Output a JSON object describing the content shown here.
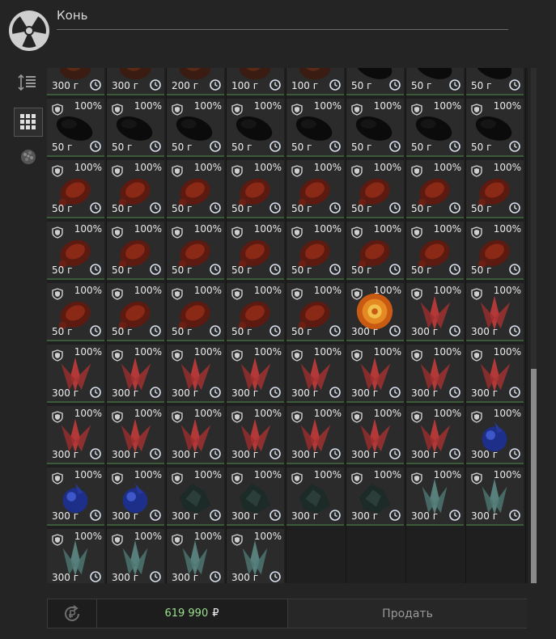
{
  "header": {
    "title": "Конь"
  },
  "sidebar": [
    {
      "name": "sort-icon",
      "active": false
    },
    {
      "name": "grid-view-icon",
      "active": true
    },
    {
      "name": "artifact-filter-icon",
      "active": false
    }
  ],
  "inventory": {
    "columns": 8,
    "item_types": {
      "black": {
        "icon": "black-artifact-icon"
      },
      "red": {
        "icon": "red-artifact-icon"
      },
      "fire": {
        "icon": "fireball-artifact-icon"
      },
      "crystal": {
        "icon": "red-crystal-artifact-icon"
      },
      "blue": {
        "icon": "blue-artifact-icon"
      },
      "dark": {
        "icon": "dark-crystal-artifact-icon"
      },
      "teal": {
        "icon": "teal-crystal-artifact-icon"
      },
      "mixed": {
        "icon": "artifact-icon"
      }
    },
    "rows": [
      [
        {
          "type": "mixed",
          "price": "300 г"
        },
        {
          "type": "mixed",
          "price": "300 г"
        },
        {
          "type": "mixed",
          "price": "200 г"
        },
        {
          "type": "mixed",
          "price": "100 г"
        },
        {
          "type": "mixed",
          "price": "100 г"
        },
        {
          "type": "black",
          "price": "50 г"
        },
        {
          "type": "black",
          "price": "50 г"
        },
        {
          "type": "black",
          "price": "50 г"
        }
      ],
      [
        {
          "type": "black",
          "price": "50 г",
          "pct": "100%"
        },
        {
          "type": "black",
          "price": "50 г",
          "pct": "100%"
        },
        {
          "type": "black",
          "price": "50 г",
          "pct": "100%"
        },
        {
          "type": "black",
          "price": "50 г",
          "pct": "100%"
        },
        {
          "type": "black",
          "price": "50 г",
          "pct": "100%"
        },
        {
          "type": "black",
          "price": "50 г",
          "pct": "100%"
        },
        {
          "type": "black",
          "price": "50 г",
          "pct": "100%"
        },
        {
          "type": "black",
          "price": "50 г",
          "pct": "100%"
        }
      ],
      [
        {
          "type": "red",
          "price": "50 г",
          "pct": "100%"
        },
        {
          "type": "red",
          "price": "50 г",
          "pct": "100%"
        },
        {
          "type": "red",
          "price": "50 г",
          "pct": "100%"
        },
        {
          "type": "red",
          "price": "50 г",
          "pct": "100%"
        },
        {
          "type": "red",
          "price": "50 г",
          "pct": "100%"
        },
        {
          "type": "red",
          "price": "50 г",
          "pct": "100%"
        },
        {
          "type": "red",
          "price": "50 г",
          "pct": "100%"
        },
        {
          "type": "red",
          "price": "50 г",
          "pct": "100%"
        }
      ],
      [
        {
          "type": "red",
          "price": "50 г",
          "pct": "100%"
        },
        {
          "type": "red",
          "price": "50 г",
          "pct": "100%"
        },
        {
          "type": "red",
          "price": "50 г",
          "pct": "100%"
        },
        {
          "type": "red",
          "price": "50 г",
          "pct": "100%"
        },
        {
          "type": "red",
          "price": "50 г",
          "pct": "100%"
        },
        {
          "type": "red",
          "price": "50 г",
          "pct": "100%"
        },
        {
          "type": "red",
          "price": "50 г",
          "pct": "100%"
        },
        {
          "type": "red",
          "price": "50 г",
          "pct": "100%"
        }
      ],
      [
        {
          "type": "red",
          "price": "50 г",
          "pct": "100%"
        },
        {
          "type": "red",
          "price": "50 г",
          "pct": "100%"
        },
        {
          "type": "red",
          "price": "50 г",
          "pct": "100%"
        },
        {
          "type": "red",
          "price": "50 г",
          "pct": "100%"
        },
        {
          "type": "red",
          "price": "50 г",
          "pct": "100%"
        },
        {
          "type": "fire",
          "price": "300 г",
          "pct": "100%"
        },
        {
          "type": "crystal",
          "price": "300 г",
          "pct": "100%"
        },
        {
          "type": "crystal",
          "price": "300 г",
          "pct": "100%"
        }
      ],
      [
        {
          "type": "crystal",
          "price": "300 г",
          "pct": "100%"
        },
        {
          "type": "crystal",
          "price": "300 г",
          "pct": "100%"
        },
        {
          "type": "crystal",
          "price": "300 г",
          "pct": "100%"
        },
        {
          "type": "crystal",
          "price": "300 г",
          "pct": "100%"
        },
        {
          "type": "crystal",
          "price": "300 г",
          "pct": "100%"
        },
        {
          "type": "crystal",
          "price": "300 г",
          "pct": "100%"
        },
        {
          "type": "crystal",
          "price": "300 г",
          "pct": "100%"
        },
        {
          "type": "crystal",
          "price": "300 г",
          "pct": "100%"
        }
      ],
      [
        {
          "type": "crystal",
          "price": "300 г",
          "pct": "100%"
        },
        {
          "type": "crystal",
          "price": "300 г",
          "pct": "100%"
        },
        {
          "type": "crystal",
          "price": "300 г",
          "pct": "100%"
        },
        {
          "type": "crystal",
          "price": "300 г",
          "pct": "100%"
        },
        {
          "type": "crystal",
          "price": "300 г",
          "pct": "100%"
        },
        {
          "type": "crystal",
          "price": "300 г",
          "pct": "100%"
        },
        {
          "type": "crystal",
          "price": "300 г",
          "pct": "100%"
        },
        {
          "type": "blue",
          "price": "300 г",
          "pct": "100%"
        }
      ],
      [
        {
          "type": "blue",
          "price": "300 г",
          "pct": "100%"
        },
        {
          "type": "blue",
          "price": "300 г",
          "pct": "100%"
        },
        {
          "type": "dark",
          "price": "300 г",
          "pct": "100%"
        },
        {
          "type": "dark",
          "price": "300 г",
          "pct": "100%"
        },
        {
          "type": "dark",
          "price": "300 г",
          "pct": "100%"
        },
        {
          "type": "dark",
          "price": "300 г",
          "pct": "100%"
        },
        {
          "type": "teal",
          "price": "300 г",
          "pct": "100%"
        },
        {
          "type": "teal",
          "price": "300 г",
          "pct": "100%"
        }
      ],
      [
        {
          "type": "teal",
          "price": "300 г",
          "pct": "100%"
        },
        {
          "type": "teal",
          "price": "300 г",
          "pct": "100%"
        },
        {
          "type": "teal",
          "price": "300 г",
          "pct": "100%"
        },
        {
          "type": "teal",
          "price": "300 г",
          "pct": "100%"
        }
      ]
    ]
  },
  "footer": {
    "balance": "619 990",
    "currency": "₽",
    "sell_label": "Продать"
  }
}
